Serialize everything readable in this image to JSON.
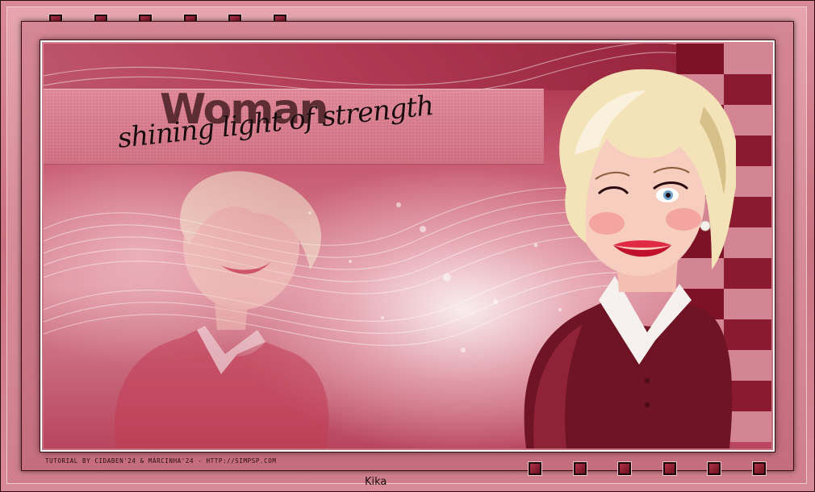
{
  "artwork": {
    "title_word": "Woman",
    "subtitle": "shining light of strength",
    "credit": "TUTORIAL BY CIDABEN'24 & MÁRCINHA'24 - HTTP://SIMPSP.COM",
    "signature": "Kika"
  },
  "palette": {
    "frame_pink": "#d9909c",
    "wine": "#8c1c33",
    "rose": "#c75a70",
    "highlight": "#ffffff",
    "dress": "#7a1a28",
    "hair": "#f4e2b8"
  },
  "decorations": {
    "top_squares_count": 6,
    "bottom_squares_count": 6
  }
}
